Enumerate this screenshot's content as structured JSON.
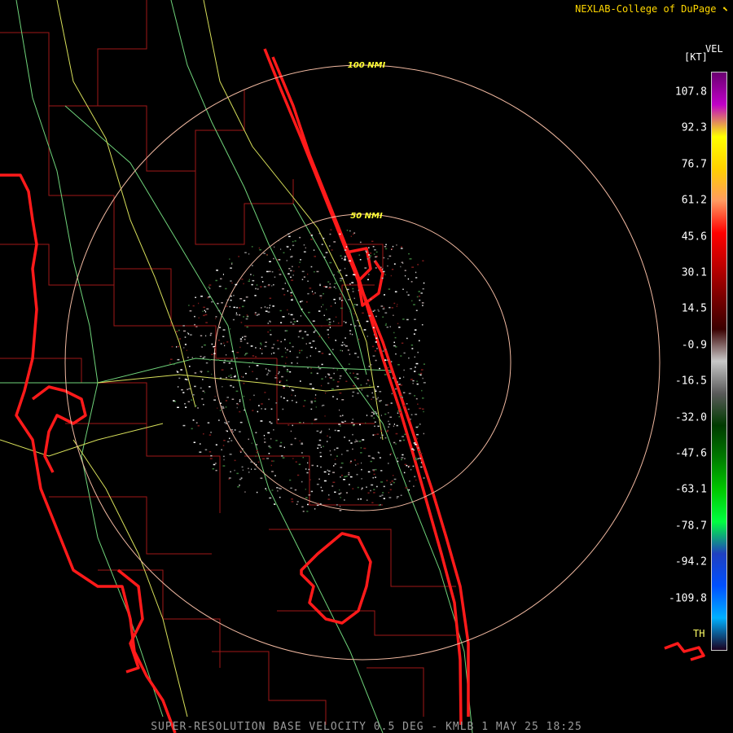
{
  "map": {
    "credit": "NEXLAB-College of DuPage",
    "credit_icon": "cursor-icon",
    "footer": "SUPER-RESOLUTION BASE VELOCITY 0.5 DEG - KMLB 1 MAY 25 18:25",
    "range_rings": [
      {
        "label": "100 NMI"
      },
      {
        "label": "50 NMI"
      }
    ],
    "colors": {
      "coastline": "#ff1a1a",
      "county_lines": "#b01a1a",
      "roads": "#d8e05a",
      "highways": "#6fd37a",
      "ring": "#f0b8a0",
      "ring_label": "#ffff33",
      "credit": "#ffd700"
    }
  },
  "scale": {
    "title": "VEL",
    "unit": "[KT]",
    "threshold_label": "TH",
    "ticks": [
      "107.8",
      "92.3",
      "76.7",
      "61.2",
      "45.6",
      "30.1",
      "14.5",
      "-0.9",
      "-16.5",
      "-32.0",
      "-47.6",
      "-63.1",
      "-78.7",
      "-94.2",
      "-109.8"
    ],
    "gradient_colors": [
      "#6a0070",
      "#c000c8",
      "#ffff00",
      "#ffd000",
      "#ff9a60",
      "#ff0000",
      "#c00000",
      "#7a0000",
      "#3a0000",
      "#c8c8c8",
      "#5a5a5a",
      "#003a00",
      "#007a00",
      "#00c800",
      "#00ff40",
      "#2040c0",
      "#0050ff",
      "#00b0ff",
      "#1a0020"
    ]
  }
}
